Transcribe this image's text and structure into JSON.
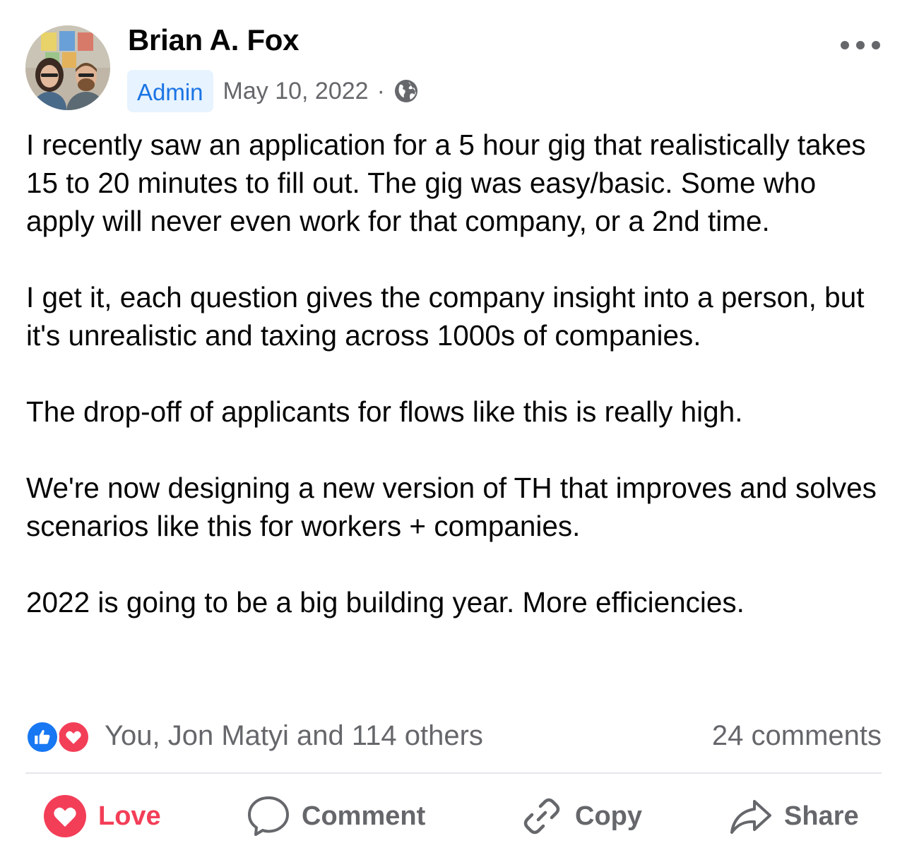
{
  "author": {
    "name": "Brian A. Fox",
    "badge": "Admin",
    "date": "May 10, 2022",
    "separator": "·",
    "visibility_icon": "globe-icon"
  },
  "menu": {
    "icon": "more-horizontal-icon"
  },
  "post": {
    "paragraphs": [
      "I recently saw an application for a 5 hour gig that realistically takes 15 to 20 minutes to fill out. The gig was easy/basic. Some who apply will never even work for that company, or a 2nd time.",
      "I get it, each question gives the company insight into a person, but it's unrealistic and taxing across 1000s of companies.",
      "The drop-off of applicants for flows like this is really high.",
      "We're now designing a new version of TH that improves and solves scenarios like this for workers + companies.",
      "2022 is going to be a big building year. More efficiencies."
    ]
  },
  "reactions": {
    "icons": [
      "like-icon",
      "love-icon"
    ],
    "summary": "You, Jon Matyi and 114 others",
    "comments": "24 comments"
  },
  "actions": {
    "love": "Love",
    "comment": "Comment",
    "copy": "Copy",
    "share": "Share"
  },
  "colors": {
    "love": "#f33e58",
    "like": "#1877f2",
    "admin_text": "#1b74e4",
    "admin_bg": "#e7f3ff",
    "secondary_text": "#65676b"
  }
}
